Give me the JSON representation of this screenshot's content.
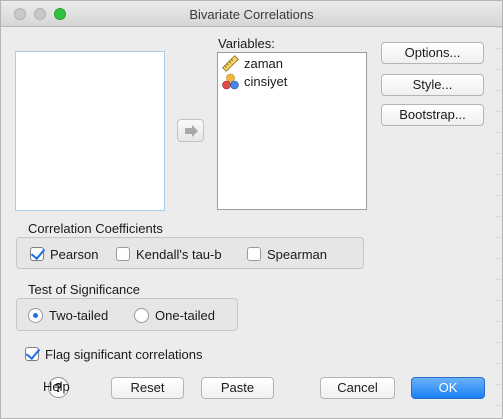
{
  "window": {
    "title": "Bivariate Correlations"
  },
  "variables": {
    "label": "Variables:",
    "items": [
      {
        "name": "zaman",
        "icon": "scale-ruler-icon"
      },
      {
        "name": "cinsiyet",
        "icon": "nominal-balls-icon"
      }
    ]
  },
  "side_buttons": {
    "options": "Options...",
    "style": "Style...",
    "bootstrap": "Bootstrap..."
  },
  "correlation": {
    "title": "Correlation Coefficients",
    "pearson": {
      "label": "Pearson",
      "checked": true
    },
    "kendall": {
      "label": "Kendall's tau-b",
      "checked": false
    },
    "spearman": {
      "label": "Spearman",
      "checked": false
    }
  },
  "significance": {
    "title": "Test of Significance",
    "two_tailed": {
      "label": "Two-tailed",
      "selected": true
    },
    "one_tailed": {
      "label": "One-tailed",
      "selected": false
    }
  },
  "flag": {
    "label": "Flag significant correlations",
    "checked": true
  },
  "bottom": {
    "help": "Help",
    "reset": "Reset",
    "paste": "Paste",
    "cancel": "Cancel",
    "ok": "OK"
  },
  "colors": {
    "accent": "#1a82f6",
    "close_dot": "#c9c9c9",
    "zoom_dot": "#2fc240"
  }
}
